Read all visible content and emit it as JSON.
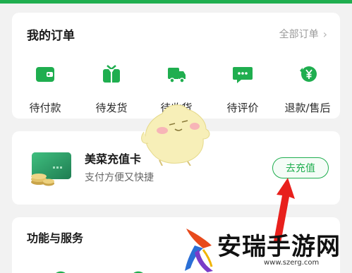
{
  "orders": {
    "title": "我的订单",
    "all_label": "全部订单",
    "items": [
      {
        "label": "待付款",
        "icon": "wallet-icon"
      },
      {
        "label": "待发货",
        "icon": "gift-box-icon"
      },
      {
        "label": "待收货",
        "icon": "delivery-truck-icon"
      },
      {
        "label": "待评价",
        "icon": "comment-bubble-icon"
      },
      {
        "label": "退款/售后",
        "icon": "refund-yen-icon"
      }
    ]
  },
  "recharge": {
    "title": "美菜充值卡",
    "subtitle": "支付方便又快捷",
    "button_label": "去充值"
  },
  "services": {
    "title": "功能与服务"
  },
  "watermark": {
    "text": "安瑞手游网",
    "url": "www.szerg.com"
  },
  "colors": {
    "brand_green": "#1fae4f",
    "arrow_red": "#e8201c"
  }
}
